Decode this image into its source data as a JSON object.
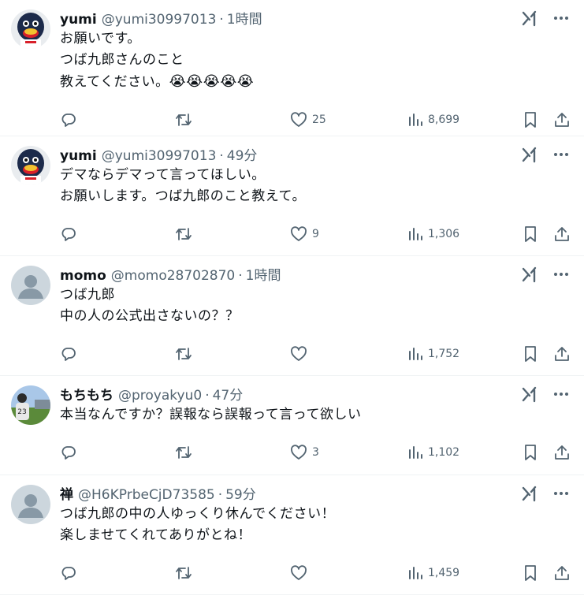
{
  "tweets": [
    {
      "name": "yumi",
      "handle": "@yumi30997013",
      "sep": "·",
      "time": "1時間",
      "lines": [
        "お願いです。",
        "つば九郎さんのこと",
        "教えてください。"
      ],
      "emoji": "😭😭😭😭😭",
      "likes": "25",
      "views": "8,699",
      "avatar": "swallow-mascot"
    },
    {
      "name": "yumi",
      "handle": "@yumi30997013",
      "sep": "·",
      "time": "49分",
      "lines": [
        "デマならデマって言ってほしい。",
        "お願いします。つば九郎のこと教えて。"
      ],
      "emoji": "",
      "likes": "9",
      "views": "1,306",
      "avatar": "swallow-mascot"
    },
    {
      "name": "momo",
      "handle": "@momo28702870",
      "sep": "·",
      "time": "1時間",
      "lines": [
        "つば九郎",
        "中の人の公式出さないの？？"
      ],
      "emoji": "",
      "likes": "",
      "views": "1,752",
      "avatar": "default-person"
    },
    {
      "name": "もちもち",
      "handle": "@proyakyu0",
      "sep": "·",
      "time": "47分",
      "lines": [
        "本当なんですか？誤報なら誤報って言って欲しい"
      ],
      "emoji": "",
      "likes": "3",
      "views": "1,102",
      "avatar": "baseball-photo"
    },
    {
      "name": "禅",
      "handle": "@H6KPrbeCjD73585",
      "sep": "·",
      "time": "59分",
      "lines": [
        "つば九郎の中の人ゆっくり休んでください！",
        "楽しませてくれてありがとね！"
      ],
      "emoji": "",
      "likes": "",
      "views": "1,459",
      "avatar": "default-person"
    }
  ],
  "colors": {
    "text": "#0f1419",
    "secondary": "#536471",
    "divider": "#eff3f4"
  },
  "icons": [
    "grok-icon",
    "more-icon",
    "reply-icon",
    "retweet-icon",
    "like-icon",
    "views-icon",
    "bookmark-icon",
    "share-icon"
  ]
}
